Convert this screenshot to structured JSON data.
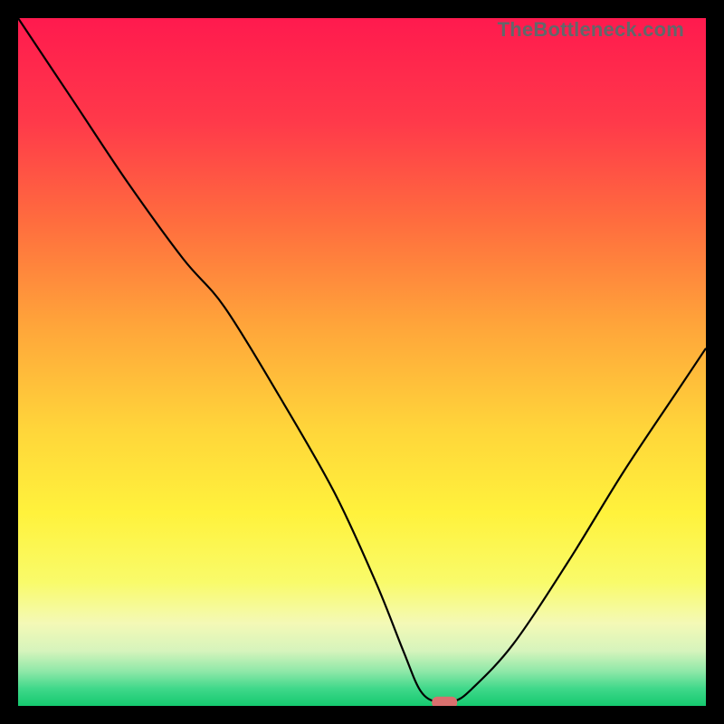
{
  "watermark": "TheBottleneck.com",
  "chart_data": {
    "type": "line",
    "title": "",
    "xlabel": "",
    "ylabel": "",
    "xlim": [
      0,
      100
    ],
    "ylim": [
      0,
      100
    ],
    "grid": false,
    "series": [
      {
        "name": "bottleneck-curve",
        "x": [
          0,
          8,
          16,
          24,
          30,
          38,
          46,
          52,
          56,
          58.5,
          61,
          63.5,
          66,
          72,
          80,
          88,
          96,
          100
        ],
        "y": [
          100,
          88,
          76,
          65,
          58,
          45,
          31,
          18,
          8,
          2.2,
          0.5,
          0.7,
          2.5,
          9,
          21,
          34,
          46,
          52
        ]
      }
    ],
    "marker": {
      "x": 62,
      "y": 0.5
    }
  },
  "gradient": {
    "stops": [
      {
        "offset": 0.0,
        "color": "#ff1a4e"
      },
      {
        "offset": 0.15,
        "color": "#ff394a"
      },
      {
        "offset": 0.3,
        "color": "#ff6e3e"
      },
      {
        "offset": 0.45,
        "color": "#ffa63a"
      },
      {
        "offset": 0.6,
        "color": "#ffd63a"
      },
      {
        "offset": 0.72,
        "color": "#fff23c"
      },
      {
        "offset": 0.82,
        "color": "#f9fb6a"
      },
      {
        "offset": 0.88,
        "color": "#f4f9b6"
      },
      {
        "offset": 0.92,
        "color": "#d6f4bc"
      },
      {
        "offset": 0.95,
        "color": "#8ee8a8"
      },
      {
        "offset": 0.975,
        "color": "#3fd88a"
      },
      {
        "offset": 1.0,
        "color": "#15c96f"
      }
    ]
  }
}
